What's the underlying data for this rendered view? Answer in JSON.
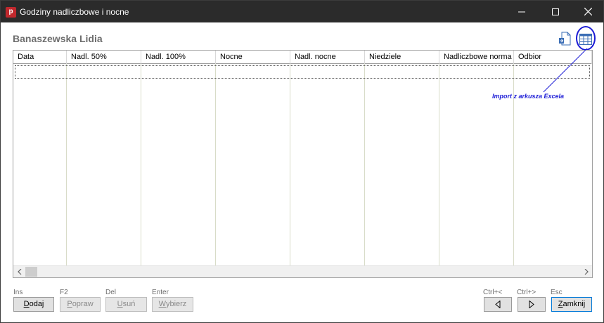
{
  "window": {
    "title": "Godziny nadliczbowe i nocne",
    "app_icon_letter": "p"
  },
  "employee_name": "Banaszewska Lidia",
  "toolbar_icons": [
    "document-import-icon",
    "excel-table-icon"
  ],
  "table": {
    "columns": [
      "Data",
      "Nadl. 50%",
      "Nadl. 100%",
      "Nocne",
      "Nadl. nocne",
      "Niedziele",
      "Nadliczbowe norma",
      "Odbior"
    ],
    "rows": []
  },
  "annotation": {
    "text": "Import z arkusza Excela",
    "color": "#1c1cd6"
  },
  "actions": {
    "add": {
      "shortcut": "Ins",
      "label_accel": "D",
      "label_rest": "odaj"
    },
    "edit": {
      "shortcut": "F2",
      "label_accel": "P",
      "label_rest": "opraw"
    },
    "delete": {
      "shortcut": "Del",
      "label_accel": "U",
      "label_rest": "suń"
    },
    "select": {
      "shortcut": "Enter",
      "label_accel": "W",
      "label_rest": "ybierz"
    },
    "prev": {
      "shortcut": "Ctrl+<"
    },
    "next": {
      "shortcut": "Ctrl+>"
    },
    "close": {
      "shortcut": "Esc",
      "label_accel": "Z",
      "label_rest": "amknij"
    }
  }
}
